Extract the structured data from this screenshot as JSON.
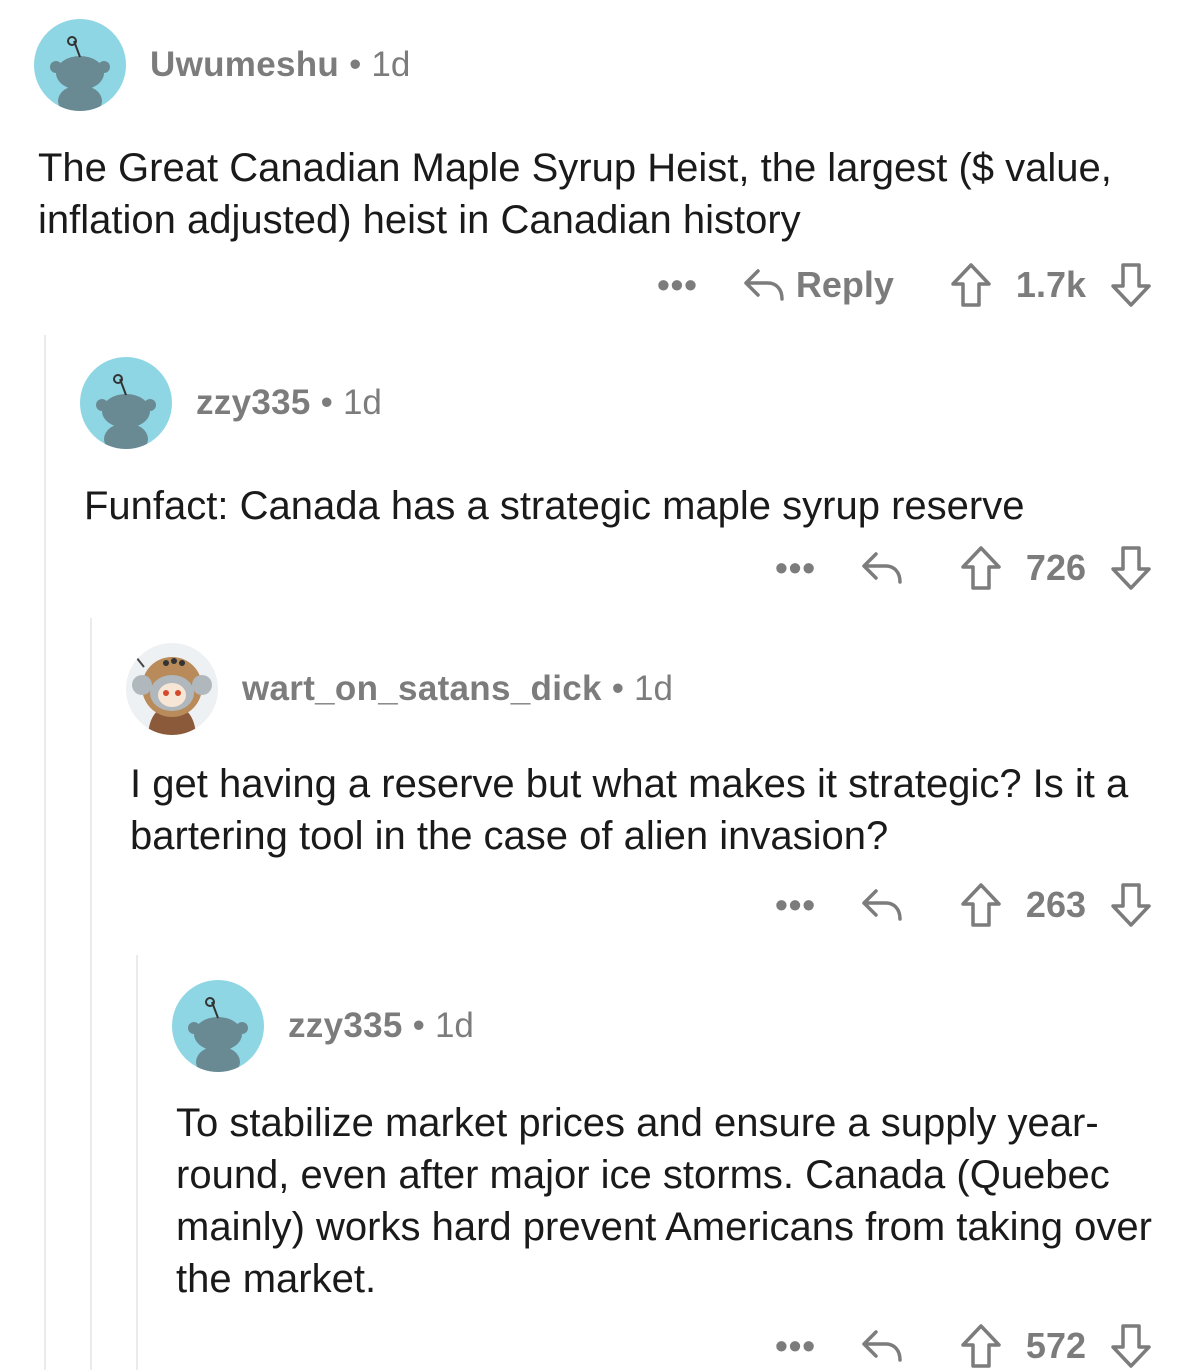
{
  "comments": [
    {
      "author": "Uwumeshu",
      "separator": "•",
      "time": "1d",
      "text": "The Great Canadian Maple Syrup Heist, the largest ($ value, inflation adjusted) heist in Canadian history",
      "more": "•••",
      "reply_label": "Reply",
      "score": "1.7k",
      "avatar": "default-snoo-icon"
    },
    {
      "author": "zzy335",
      "separator": "•",
      "time": "1d",
      "text": "Funfact: Canada has a strategic maple syrup reserve",
      "more": "•••",
      "score": "726",
      "avatar": "default-snoo-icon"
    },
    {
      "author": "wart_on_satans_dick",
      "separator": "•",
      "time": "1d",
      "text": "I get having a reserve but what makes it strategic? Is it a bartering tool in the case of alien invasion?",
      "more": "•••",
      "score": "263",
      "avatar": "custom-snoo-astronaut-icon"
    },
    {
      "author": "zzy335",
      "separator": "•",
      "time": "1d",
      "text": "To stabilize market prices and ensure a supply year-round, even after major ice storms.  Canada (Quebec mainly) works hard prevent Americans from taking over the market.",
      "more": "•••",
      "score": "572",
      "avatar": "default-snoo-icon"
    }
  ],
  "colors": {
    "avatar_bg": "#8fd6e4",
    "meta_text": "#7c7c7c",
    "body_text": "#1a1a1b",
    "thread_line": "#e9ecef"
  }
}
